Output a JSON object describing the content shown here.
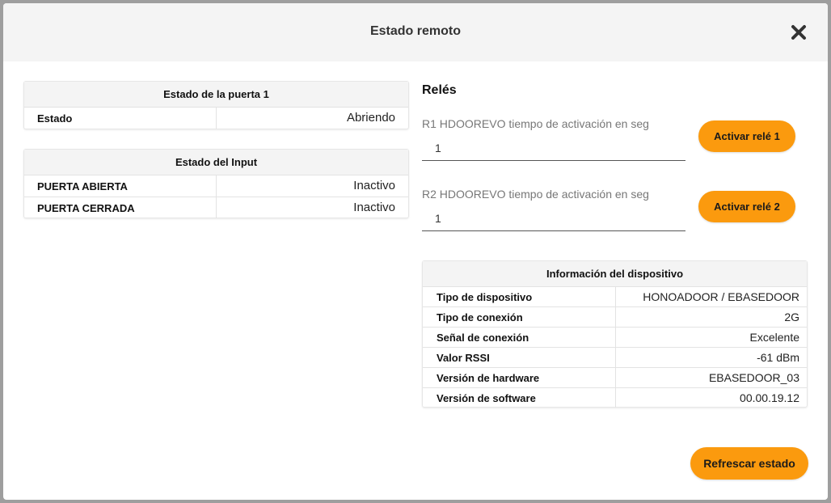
{
  "dialog": {
    "title": "Estado remoto",
    "close_icon": "close-x-icon"
  },
  "door_status": {
    "title": "Estado de la puerta 1",
    "rows": [
      {
        "label": "Estado",
        "value": "Abriendo"
      }
    ]
  },
  "input_status": {
    "title": "Estado del Input",
    "rows": [
      {
        "label": "PUERTA ABIERTA",
        "value": "Inactivo"
      },
      {
        "label": "PUERTA CERRADA",
        "value": "Inactivo"
      }
    ]
  },
  "relays": {
    "title": "Relés",
    "items": [
      {
        "label": "R1 HDOOREVO tiempo de activación en seg",
        "value": "1",
        "button": "Activar relé 1"
      },
      {
        "label": "R2 HDOOREVO tiempo de activación en seg",
        "value": "1",
        "button": "Activar relé 2"
      }
    ]
  },
  "device_info": {
    "title": "Información del dispositivo",
    "rows": [
      {
        "label": "Tipo de dispositivo",
        "value": "HONOADOOR / EBASEDOOR"
      },
      {
        "label": "Tipo de conexión",
        "value": "2G"
      },
      {
        "label": "Señal de conexión",
        "value": "Excelente"
      },
      {
        "label": "Valor RSSI",
        "value": "-61 dBm"
      },
      {
        "label": "Versión de hardware",
        "value": "EBASEDOOR_03"
      },
      {
        "label": "Versión de software",
        "value": "00.00.19.12"
      }
    ]
  },
  "footer": {
    "refresh_label": "Refrescar estado"
  },
  "colors": {
    "accent": "#fb9a0e",
    "header_bg": "#f4f4f4"
  }
}
